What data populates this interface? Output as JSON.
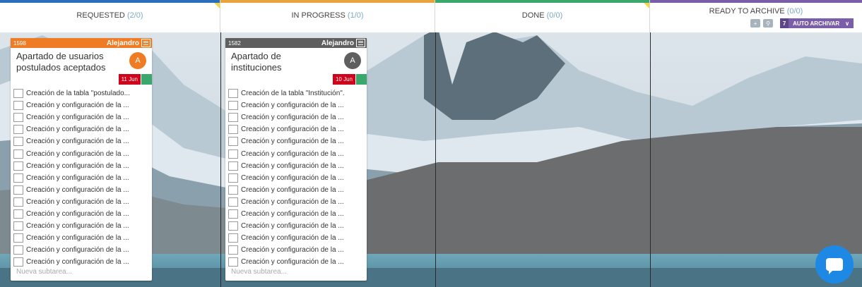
{
  "columns": [
    {
      "title": "REQUESTED",
      "count": "(2/0)",
      "color": "#2a6ebb"
    },
    {
      "title": "IN PROGRESS",
      "count": "(1/0)",
      "color": "#e8a33a"
    },
    {
      "title": "DONE",
      "count": "(0/0)",
      "color": "#3aa76d"
    },
    {
      "title": "READY TO ARCHIVE",
      "count": "(0/0)",
      "color": "#7a5ea8"
    }
  ],
  "archive": {
    "select_number": "7",
    "select_label": "AUTO ARCHIVAR",
    "chevron_icon": "chevron-down-icon"
  },
  "cards": [
    {
      "id": "1598",
      "owner": "Alejandro",
      "header_color": "#f07b25",
      "title_line1": "Apartado de usuarios",
      "title_line2": "postulados aceptados",
      "avatar_letter": "A",
      "avatar_color": "#f07b25",
      "date": "11 Jun",
      "subtasks": [
        "Creación de la tabla \"postulado...",
        "Creación y configuración de la ...",
        "Creación y configuración de la ...",
        "Creación y configuración de la ...",
        "Creación y configuración de la ...",
        "Creación y configuración de la ...",
        "Creación y configuración de la ...",
        "Creación y configuración de la ...",
        "Creación y configuración de la ...",
        "Creación y configuración de la ...",
        "Creación y configuración de la ...",
        "Creación y configuración de la ...",
        "Creación y configuración de la ...",
        "Creación y configuración de la ...",
        "Creación y configuración de la ..."
      ],
      "new_subtask_placeholder": "Nueva subtarea..."
    },
    {
      "id": "1582",
      "owner": "Alejandro",
      "header_color": "#5f5f5f",
      "title_line1": "Apartado de",
      "title_line2": "instituciones",
      "avatar_letter": "A",
      "avatar_color": "#5f5f5f",
      "date": "10 Jun",
      "subtasks": [
        "Creación de la tabla \"Institución\".",
        "Creación y configuración de la ...",
        "Creación y configuración de la ...",
        "Creación y configuración de la ...",
        "Creación y configuración de la ...",
        "Creación y configuración de la ...",
        "Creación y configuración de la ...",
        "Creación y configuración de la ...",
        "Creación y configuración de la ...",
        "Creación y configuración de la ...",
        "Creación y configuración de la ...",
        "Creación y configuración de la ...",
        "Creación y configuración de la ...",
        "Creación y configuración de la ...",
        "Creación y configuración de la ..."
      ],
      "new_subtask_placeholder": "Nueva subtarea..."
    }
  ]
}
